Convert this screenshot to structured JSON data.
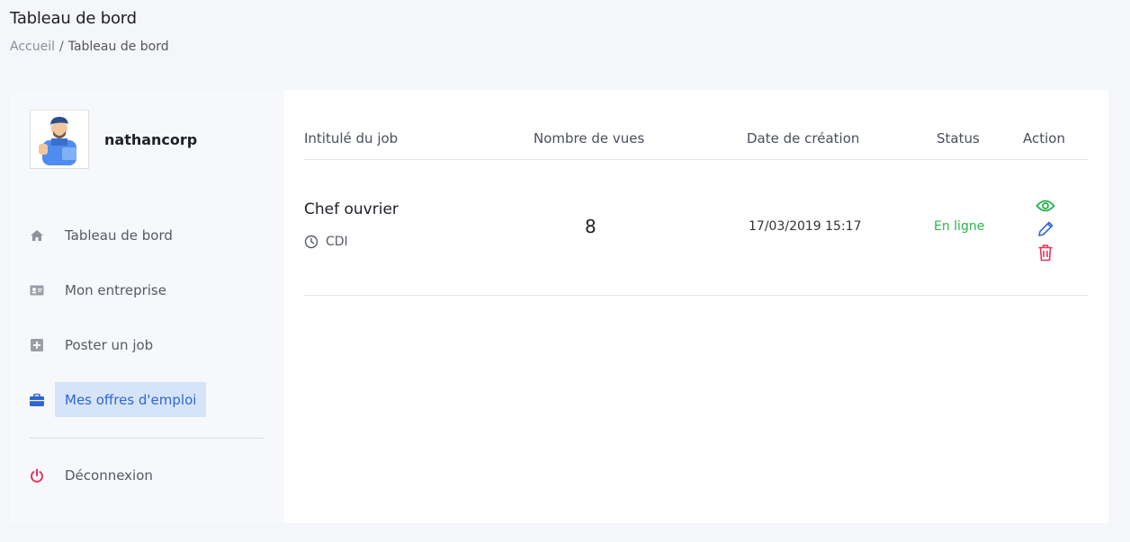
{
  "page": {
    "title": "Tableau de bord",
    "breadcrumb": {
      "home": "Accueil",
      "separator": "/",
      "current": "Tableau de bord"
    }
  },
  "sidebar": {
    "company_name": "nathancorp",
    "items": [
      {
        "label": "Tableau de bord",
        "icon": "home-icon"
      },
      {
        "label": "Mon entreprise",
        "icon": "id-card-icon"
      },
      {
        "label": "Poster un job",
        "icon": "plus-square-icon"
      },
      {
        "label": "Mes offres d'emploi",
        "icon": "briefcase-icon",
        "active": true
      },
      {
        "label": "Déconnexion",
        "icon": "power-icon"
      }
    ]
  },
  "table": {
    "headers": {
      "job_title": "Intitulé du job",
      "views": "Nombre de vues",
      "created": "Date de création",
      "status": "Status",
      "action": "Action"
    },
    "rows": [
      {
        "title": "Chef ouvrier",
        "contract": "CDI",
        "views": "8",
        "created": "17/03/2019 15:17",
        "status": "En ligne"
      }
    ]
  },
  "colors": {
    "accent": "#2f66d0",
    "active_bg": "#d6e4fa",
    "status_online": "#29b34a",
    "view_icon": "#22b54a",
    "edit_icon": "#2f66d0",
    "delete_icon": "#e8345a",
    "logout_icon": "#e8345a"
  }
}
